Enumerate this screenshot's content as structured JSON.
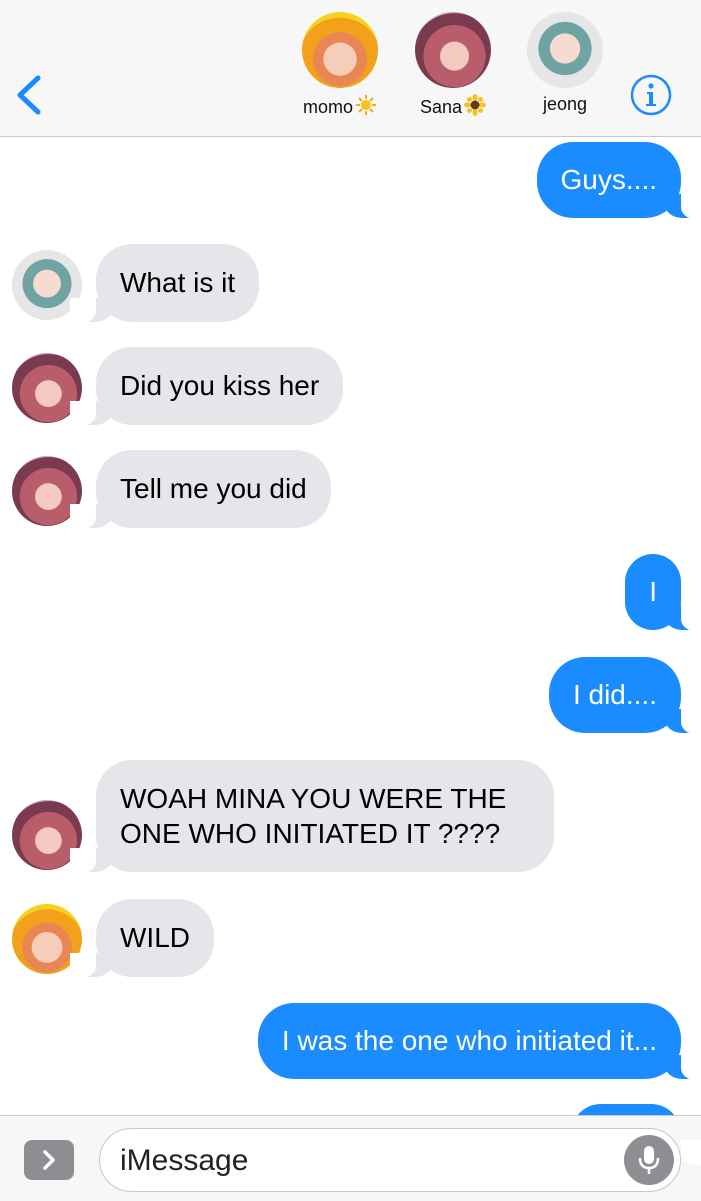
{
  "header": {
    "contacts": [
      {
        "name": "momo",
        "emoji": "sun"
      },
      {
        "name": "Sana",
        "emoji": "sunflower"
      },
      {
        "name": "jeong",
        "emoji": ""
      }
    ]
  },
  "messages": [
    {
      "side": "sent",
      "text": "Guys...."
    },
    {
      "side": "received",
      "sender": "jeong",
      "text": "What is it"
    },
    {
      "side": "received",
      "sender": "Sana",
      "text": "Did you kiss her"
    },
    {
      "side": "received",
      "sender": "Sana",
      "text": "Tell me you did"
    },
    {
      "side": "sent",
      "text": "I"
    },
    {
      "side": "sent",
      "text": "I did...."
    },
    {
      "side": "received",
      "sender": "Sana",
      "text": "WOAH MINA YOU WERE THE ONE WHO INITIATED IT ????"
    },
    {
      "side": "received",
      "sender": "momo",
      "text": "WILD"
    },
    {
      "side": "sent",
      "text": "I was the one who initiated it..."
    }
  ],
  "composer": {
    "placeholder": "iMessage"
  },
  "colors": {
    "sent_bubble": "#1a8cff",
    "received_bubble": "#e5e5ea",
    "accent": "#1a8cff"
  }
}
